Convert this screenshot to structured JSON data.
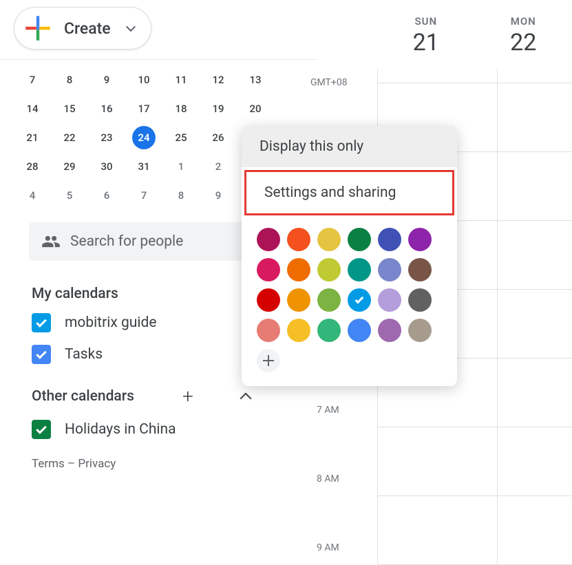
{
  "create": {
    "label": "Create"
  },
  "mini_calendar": {
    "rows": [
      [
        {
          "d": "7"
        },
        {
          "d": "8"
        },
        {
          "d": "9"
        },
        {
          "d": "10"
        },
        {
          "d": "11"
        },
        {
          "d": "12"
        },
        {
          "d": "13"
        }
      ],
      [
        {
          "d": "14"
        },
        {
          "d": "15"
        },
        {
          "d": "16"
        },
        {
          "d": "17"
        },
        {
          "d": "18"
        },
        {
          "d": "19"
        },
        {
          "d": "20"
        }
      ],
      [
        {
          "d": "21"
        },
        {
          "d": "22"
        },
        {
          "d": "23"
        },
        {
          "d": "24",
          "today": true
        },
        {
          "d": "25"
        },
        {
          "d": "26"
        },
        {
          "d": ""
        }
      ],
      [
        {
          "d": "28"
        },
        {
          "d": "29"
        },
        {
          "d": "30"
        },
        {
          "d": "31"
        },
        {
          "d": "1",
          "dim": true
        },
        {
          "d": "2",
          "dim": true
        },
        {
          "d": ""
        }
      ],
      [
        {
          "d": "4",
          "dim": true
        },
        {
          "d": "5",
          "dim": true
        },
        {
          "d": "6",
          "dim": true
        },
        {
          "d": "7",
          "dim": true
        },
        {
          "d": "8",
          "dim": true
        },
        {
          "d": "9",
          "dim": true
        },
        {
          "d": ""
        }
      ]
    ]
  },
  "search": {
    "placeholder": "Search for people"
  },
  "my_calendars": {
    "title": "My calendars",
    "items": [
      {
        "label": "mobitrix guide",
        "color": "#039be5"
      },
      {
        "label": "Tasks",
        "color": "#4285f4"
      }
    ]
  },
  "other_calendars": {
    "title": "Other calendars",
    "items": [
      {
        "label": "Holidays in China",
        "color": "#0b8043"
      }
    ]
  },
  "footer": {
    "terms": "Terms",
    "dash": " – ",
    "privacy": "Privacy"
  },
  "main": {
    "tz": "GMT+08",
    "days": [
      {
        "name": "SUN",
        "num": "21"
      },
      {
        "name": "MON",
        "num": "22"
      }
    ],
    "hours": [
      "7 AM",
      "8 AM",
      "9 AM"
    ]
  },
  "popup": {
    "display_only": "Display this only",
    "settings": "Settings and sharing",
    "colors": [
      [
        "#ad1457",
        "#f4511e",
        "#e4c441",
        "#0b8043",
        "#3f51b5",
        "#8e24aa"
      ],
      [
        "#d81b60",
        "#ef6c00",
        "#c0ca33",
        "#009688",
        "#7986cb",
        "#795548"
      ],
      [
        "#d50000",
        "#f09300",
        "#7cb342",
        "#039be5",
        "#b39ddb",
        "#616161"
      ],
      [
        "#e67c73",
        "#f6bf26",
        "#33b679",
        "#4285f4",
        "#9e69af",
        "#a79b8e"
      ]
    ],
    "selected": "#039be5"
  }
}
